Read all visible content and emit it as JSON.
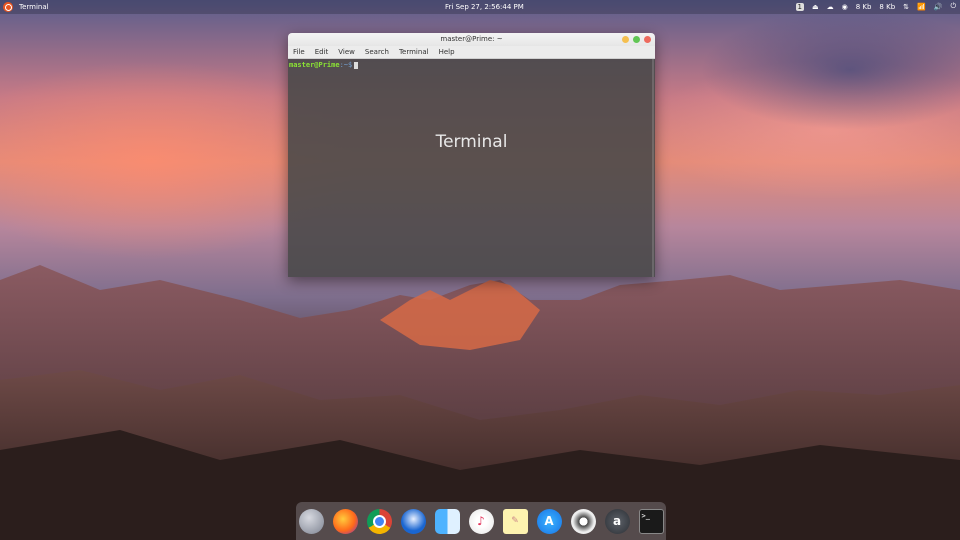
{
  "topbar": {
    "active_app": "Terminal",
    "clock": "Fri Sep 27,  2:56:44 PM",
    "workspace": "1",
    "tray_labels": [
      "⏏",
      "☁",
      "◉",
      "8 Kb",
      "8 Kb",
      "⇅",
      "📶",
      "🔊",
      "⏻"
    ]
  },
  "terminal": {
    "title": "master@Prime: ~",
    "menu": [
      "File",
      "Edit",
      "View",
      "Search",
      "Terminal",
      "Help"
    ],
    "prompt_user": "master@Prime",
    "prompt_path": ":~$",
    "watermark": "Terminal"
  },
  "dock": {
    "items": [
      {
        "icon": "rocket-icon",
        "glyph": ""
      },
      {
        "icon": "firefox-icon",
        "glyph": ""
      },
      {
        "icon": "chrome-icon",
        "glyph": ""
      },
      {
        "icon": "thunderbird-icon",
        "glyph": ""
      },
      {
        "icon": "finder-icon",
        "glyph": ""
      },
      {
        "icon": "itunes-icon",
        "glyph": "♪"
      },
      {
        "icon": "notes-icon",
        "glyph": "✎"
      },
      {
        "icon": "appstore-icon",
        "glyph": "A"
      },
      {
        "icon": "settings-icon",
        "glyph": ""
      },
      {
        "icon": "amazon-icon",
        "glyph": "a"
      },
      {
        "icon": "terminal-icon",
        "glyph": ">_"
      }
    ]
  },
  "colors": {
    "ubuntu_orange": "#e95420",
    "prompt_green": "#8ae234",
    "prompt_blue": "#729fcf"
  }
}
